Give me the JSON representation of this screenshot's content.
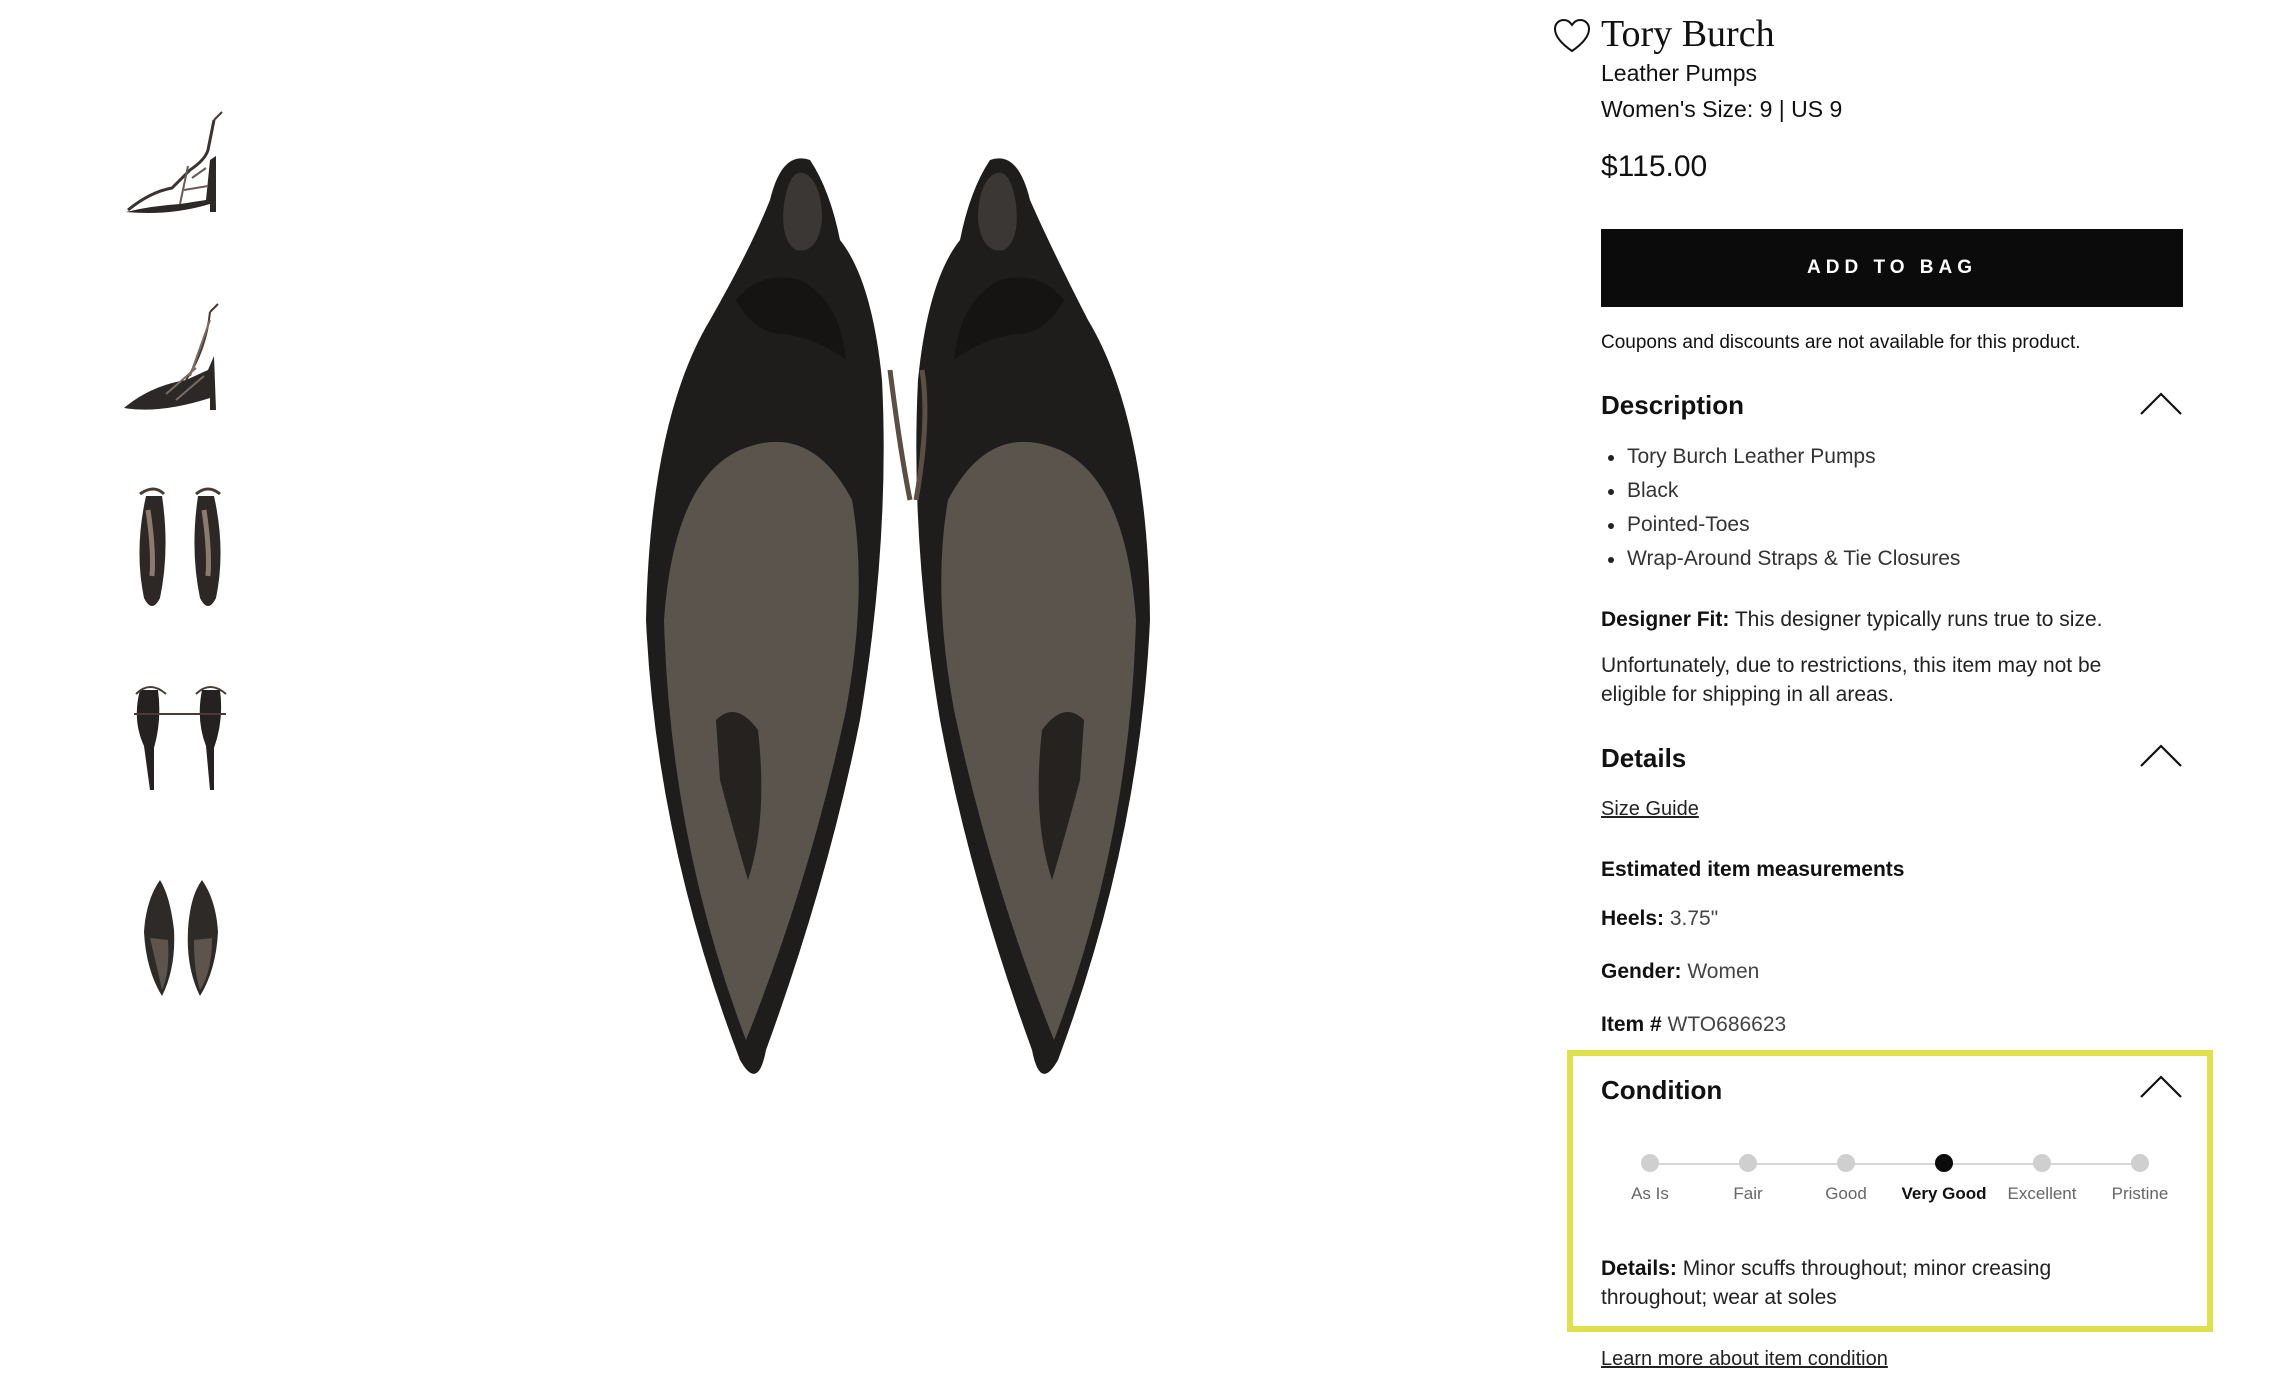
{
  "thumbnails": [
    {
      "label": "thumb-side-view"
    },
    {
      "label": "thumb-angle-view"
    },
    {
      "label": "thumb-top-view"
    },
    {
      "label": "thumb-back-view"
    },
    {
      "label": "thumb-sole-view"
    }
  ],
  "product": {
    "brand": "Tory Burch",
    "name": "Leather Pumps",
    "size": "Women's Size: 9 | US 9",
    "price": "$115.00"
  },
  "actions": {
    "add_to_bag": "ADD TO BAG",
    "coupon_note": "Coupons and discounts are not available for this product."
  },
  "description": {
    "title": "Description",
    "items": [
      "Tory Burch Leather Pumps",
      "Black",
      "Pointed-Toes",
      "Wrap-Around Straps & Tie Closures"
    ],
    "fit_label": "Designer Fit:",
    "fit_text": " This designer typically runs true to size.",
    "shipping_note": "Unfortunately, due to restrictions, this item may not be eligible for shipping in all areas."
  },
  "details": {
    "title": "Details",
    "size_guide": "Size Guide",
    "measurements_title": "Estimated item measurements",
    "heels_label": "Heels:",
    "heels_value": " 3.75\"",
    "gender_label": "Gender:",
    "gender_value": " Women",
    "item_label": "Item #",
    "item_value": " WTO686623"
  },
  "condition": {
    "title": "Condition",
    "levels": [
      "As Is",
      "Fair",
      "Good",
      "Very Good",
      "Excellent",
      "Pristine"
    ],
    "selected": "Very Good",
    "details_label": "Details:",
    "details_text": " Minor scuffs throughout; minor creasing throughout; wear at soles",
    "learn_more": "Learn more about item condition",
    "highlight_color": "#dfe04a"
  },
  "icons": {
    "favorite": "heart-outline-icon",
    "collapse": "chevron-up-icon"
  }
}
